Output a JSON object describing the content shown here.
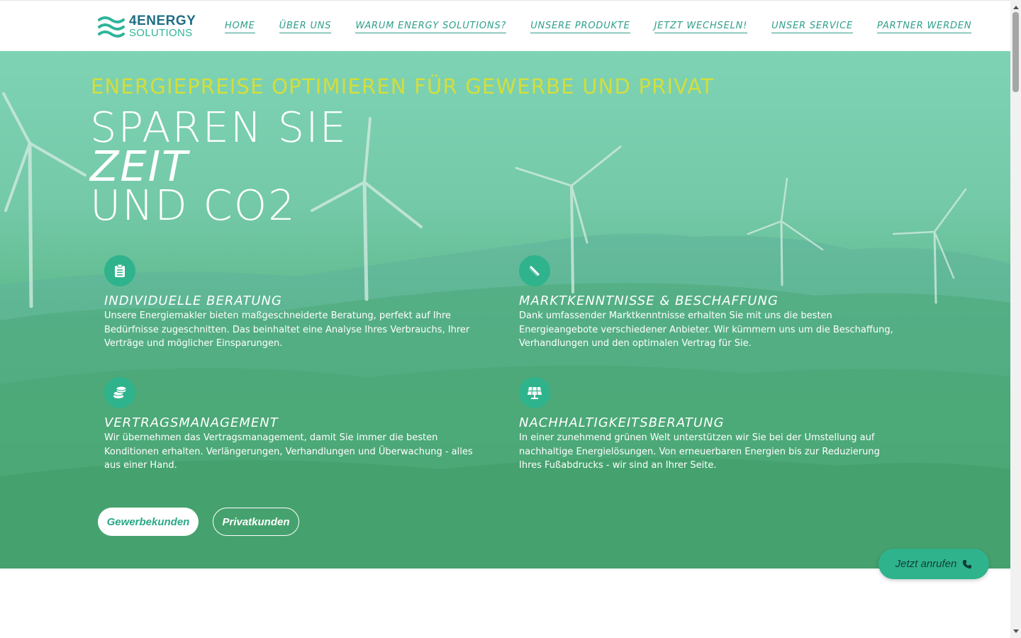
{
  "header": {
    "logo": {
      "line1": "4ENERGY",
      "line2": "SOLUTIONS"
    },
    "nav": [
      {
        "label": "HOME"
      },
      {
        "label": "ÜBER UNS"
      },
      {
        "label": "WARUM ENERGY SOLUTIONS?"
      },
      {
        "label": "UNSERE PRODUKTE"
      },
      {
        "label": "JETZT WECHSELN!"
      },
      {
        "label": "UNSER SERVICE"
      },
      {
        "label": "PARTNER WERDEN"
      }
    ]
  },
  "hero": {
    "kicker": "ENERGIEPREISE OPTIMIEREN FÜR GEWERBE UND PRIVAT",
    "headline": {
      "line1": "SPAREN SIE",
      "line2": "ZEIT",
      "line3": "UND CO2"
    },
    "features": [
      {
        "icon": "clipboard-list-icon",
        "title": "INDIVIDUELLE BERATUNG",
        "text": "Unsere Energiemakler bieten maßgeschneiderte Beratung, perfekt auf Ihre Bedürfnisse zugeschnitten. Das beinhaltet eine Analyse Ihres Verbrauchs, Ihrer Verträge und möglicher Einsparungen."
      },
      {
        "icon": "pencil-ruler-icon",
        "title": "MARKTKENNTNISSE & BESCHAFFUNG",
        "text": "Dank umfassender Marktkenntnisse erhalten Sie mit uns die besten Energieangebote verschiedener Anbieter. Wir kümmern uns um die Beschaffung, Verhandlungen und den optimalen Vertrag für Sie."
      },
      {
        "icon": "coins-icon",
        "title": "VERTRAGSMANAGEMENT",
        "text": "Wir übernehmen das Vertragsmanagement, damit Sie immer die besten Konditionen erhalten. Verlängerungen, Verhandlungen und Überwachung - alles aus einer Hand."
      },
      {
        "icon": "solar-panel-icon",
        "title": "NACHHALTIGKEITSBERATUNG",
        "text": "In einer zunehmend grünen Welt unterstützen wir Sie bei der Umstellung auf nachhaltige Energielösungen. Von erneuerbaren Energien bis zur Reduzierung Ihres Fußabdrucks - wir sind an Ihrer Seite."
      }
    ],
    "buttons": {
      "business": "Gewerbekunden",
      "private": "Privatkunden"
    }
  },
  "call_button": {
    "label": "Jetzt anrufen",
    "icon": "phone-icon"
  },
  "colors": {
    "accent": "#2fb38c",
    "kicker": "#d3de3c",
    "nav": "#2f9f8c",
    "logo_dark": "#1f6d83"
  }
}
